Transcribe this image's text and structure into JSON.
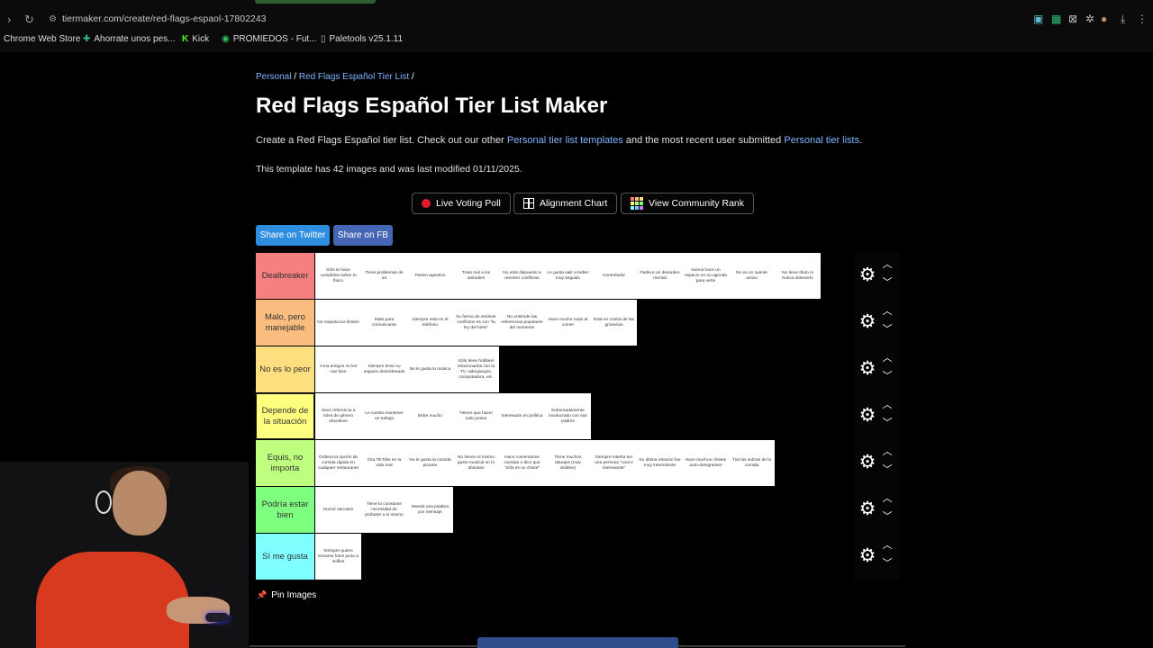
{
  "browser": {
    "url": "tiermaker.com/create/red-flags-espaol-17802243",
    "bookmarks": [
      {
        "label": "Chrome Web Store",
        "icon": "rainbow-icon"
      },
      {
        "label": "Ahorrate unos pes...",
        "icon": "puzzle-icon",
        "color": "#2ec27e"
      },
      {
        "label": "Kick",
        "icon": "kick-icon",
        "color": "#53fc18"
      },
      {
        "label": "PROMIEDOS - Fut...",
        "icon": "ball-icon",
        "color": "#38c25a"
      },
      {
        "label": "Paletools v25.1.11",
        "icon": "page-icon"
      }
    ]
  },
  "breadcrumb": {
    "first": "Personal",
    "sep1": " / ",
    "second": "Red Flags Español Tier List",
    "sep2": " /"
  },
  "title": "Red Flags Español Tier List Maker",
  "description": {
    "pre": "Create a Red Flags Español tier list. Check out our other ",
    "link1": "Personal tier list templates",
    "mid": " and the most recent user submitted ",
    "link2": "Personal tier lists",
    "post": "."
  },
  "meta": "This template has 42 images and was last modified 01/11/2025.",
  "buttons": {
    "live_voting": "Live Voting Poll",
    "alignment": "Alignment Chart",
    "community_rank": "View Community Rank"
  },
  "share": {
    "twitter": "Share on Twitter",
    "fb": "Share on FB"
  },
  "tiers": [
    {
      "label": "Dealbreaker",
      "color": "#f67f7f",
      "items": [
        "Sólo te hace cumplidos sobre tu físico",
        "Tiene problemas de ira",
        "Pasivo agresivo",
        "Trata mal a los animales",
        "No está dispuesto a resolver conflictos",
        "Le gusta salir a beber muy seguido",
        "Controlador",
        "Padece un desorden mental",
        "Nunca hace un espacio en su agenda para verte",
        "No es un oyente activo",
        "No tiene título ni busca obtenerlo"
      ]
    },
    {
      "label": "Malo, pero manejable",
      "color": "#f8bd7f",
      "items": [
        "No respeta tus límites",
        "Malo para comunicarse",
        "Siempre está en el teléfono",
        "Su forma de resolver conflictos es con \"la ley del hielo\"",
        "No entiende las referencias populares del momento",
        "Hace mucho ruido al comer",
        "Está en contra de las groserías"
      ]
    },
    {
      "label": "No es lo peor",
      "color": "#fedf80",
      "items": [
        "A tus amigos no les cae bien",
        "Siempre tiene su espacio desordenado",
        "No le gusta la música",
        "Sólo tiene hobbies relacionados con la TV, videojuegos, computadora, etc."
      ]
    },
    {
      "label": "Depende de la situación",
      "color": "#feff7f",
      "selected": true,
      "items": [
        "Hace referencia a roles de género obsoletos",
        "Le cuesta mantener un trabajo",
        "Bebe mucho",
        "Tienen que hacer todo juntos",
        "Interesado en política",
        "Extremadamente involucrado con sus padres"
      ]
    },
    {
      "label": "Equis, no importa",
      "color": "#bfff7f",
      "items": [
        "Ordena la opción de comida rápida en cualquier restaurante",
        "Cita TikToks en la vida real",
        "No le gusta la comida picante",
        "No tienen el mismo gusto musical en lo absoluto",
        "Hace comentarios racistas o dice que \"sólo es un chiste\"",
        "Tiene muchos tatuajes (muy visibles)",
        "Siempre intenta ser una persona \"cool e interesante\"",
        "Su última relación fue muy intermitente",
        "Hace muchos chistes auto-denigrantes",
        "Tira las sobras de la comida"
      ]
    },
    {
      "label": "Podría estar bien",
      "color": "#7fff7f",
      "items": [
        "Humor sarcasm",
        "Tiene la constante necesidad de probarte a sí mismo",
        "Manda una palabra por mensaje"
      ]
    },
    {
      "label": "Sí me gusta",
      "color": "#7fffff",
      "items": [
        "Siempre quiere tomarse fotos junto a selfies"
      ]
    }
  ],
  "pin_images": "Pin Images",
  "colors": {
    "link": "#7fb5ff",
    "twitter": "#2f8de0",
    "facebook": "#4466b5",
    "live_dot": "#e01d2e"
  }
}
